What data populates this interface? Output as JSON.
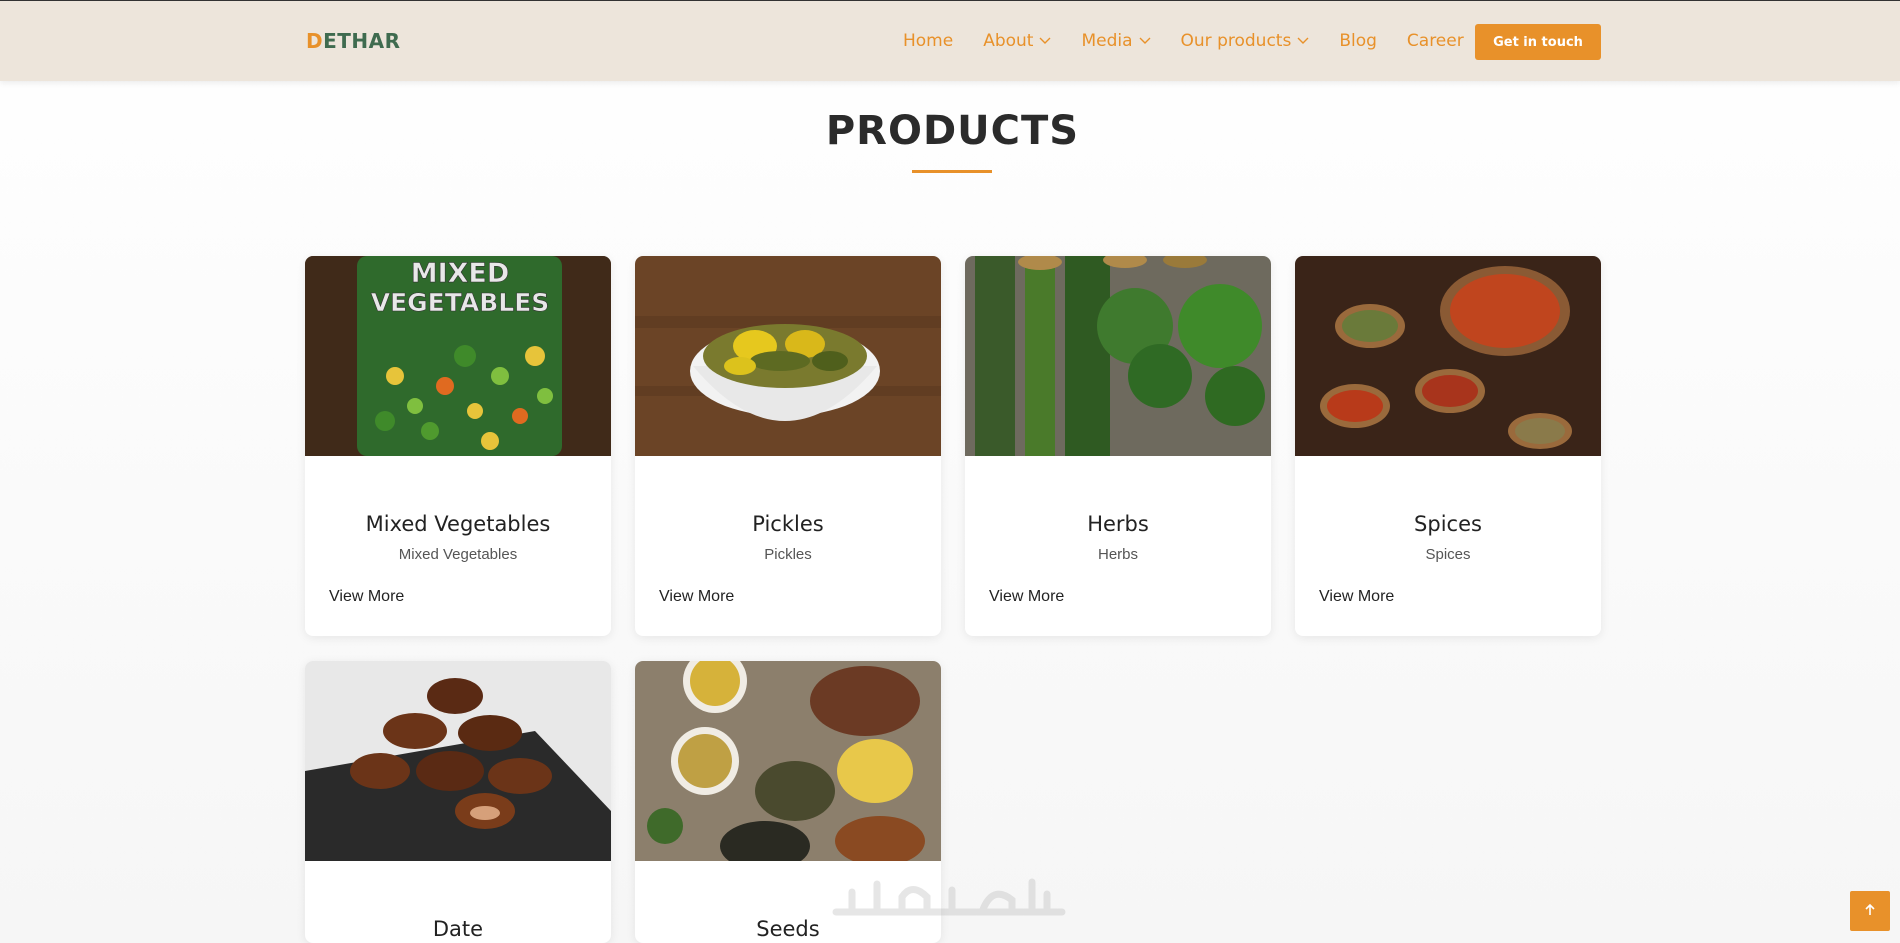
{
  "brand": {
    "logo_first": "D",
    "logo_rest": "ETHAR",
    "accent": "#e8912a",
    "logo_color": "#3f6b4f"
  },
  "nav": {
    "items": [
      {
        "label": "Home"
      },
      {
        "label": "About",
        "has_dropdown": true
      },
      {
        "label": "Media",
        "has_dropdown": true
      },
      {
        "label": "Our products",
        "has_dropdown": true
      },
      {
        "label": "Blog"
      },
      {
        "label": "Career"
      }
    ],
    "cta_label": "Get in touch"
  },
  "page": {
    "title": "PRODUCTS"
  },
  "products": [
    {
      "name": "Mixed Vegetables",
      "subtitle": "Mixed Vegetables",
      "link": "View More",
      "image_text": "MIXED\nVEGETABLES"
    },
    {
      "name": "Pickles",
      "subtitle": "Pickles",
      "link": "View More"
    },
    {
      "name": "Herbs",
      "subtitle": "Herbs",
      "link": "View More"
    },
    {
      "name": "Spices",
      "subtitle": "Spices",
      "link": "View More"
    },
    {
      "name": "Date"
    },
    {
      "name": "Seeds"
    }
  ],
  "icons": {
    "chevron": "chevron-down-icon",
    "scroll_top": "arrow-up-icon"
  }
}
